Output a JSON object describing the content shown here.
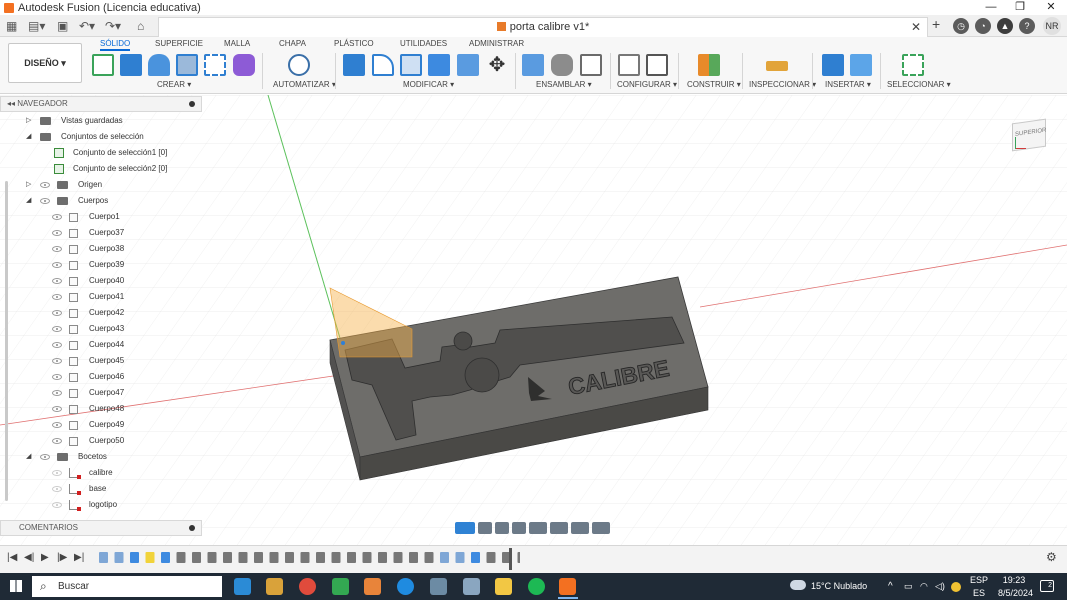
{
  "window": {
    "title": "Autodesk Fusion (Licencia educativa)",
    "user_initials": "NR"
  },
  "document": {
    "title": "porta calibre v1*"
  },
  "ribbon": {
    "workspace": "DISEÑO ▾",
    "tabs": [
      "SÓLIDO",
      "SUPERFICIE",
      "MALLA",
      "CHAPA",
      "PLÁSTICO",
      "UTILIDADES",
      "ADMINISTRAR"
    ],
    "groups": [
      "CREAR ▾",
      "AUTOMATIZAR ▾",
      "MODIFICAR ▾",
      "ENSAMBLAR ▾",
      "CONFIGURAR ▾",
      "CONSTRUIR ▾",
      "INSPECCIONAR ▾",
      "INSERTAR ▾",
      "SELECCIONAR ▾"
    ]
  },
  "browser": {
    "header": "NAVEGADOR",
    "items": {
      "saved_views": "Vistas guardadas",
      "selection_sets": "Conjuntos de selección",
      "set1": "Conjunto de selección1 [0]",
      "set2": "Conjunto de selección2 [0]",
      "origin": "Origen",
      "bodies": "Cuerpos",
      "sketches": "Bocetos"
    },
    "bodies_list": [
      "Cuerpo1",
      "Cuerpo37",
      "Cuerpo38",
      "Cuerpo39",
      "Cuerpo40",
      "Cuerpo41",
      "Cuerpo42",
      "Cuerpo43",
      "Cuerpo44",
      "Cuerpo45",
      "Cuerpo46",
      "Cuerpo47",
      "Cuerpo48",
      "Cuerpo49",
      "Cuerpo50"
    ],
    "sketches_list": [
      "calibre",
      "base",
      "logotipo"
    ]
  },
  "comments": {
    "label": "COMENTARIOS"
  },
  "viewcube": {
    "face": "SUPERIOR"
  },
  "model": {
    "engraved_text": "CALIBRE"
  },
  "taskbar": {
    "search_placeholder": "Buscar",
    "weather": "15°C  Nublado",
    "language": "ESP",
    "language_sub": "ES",
    "time": "19:23",
    "date": "8/5/2024",
    "notifications": "2"
  },
  "colors": {
    "accent": "#0a6ad6",
    "model_top": "#6b6a67",
    "model_side": "#4f4e4b",
    "taskbar": "#1f2a36"
  }
}
